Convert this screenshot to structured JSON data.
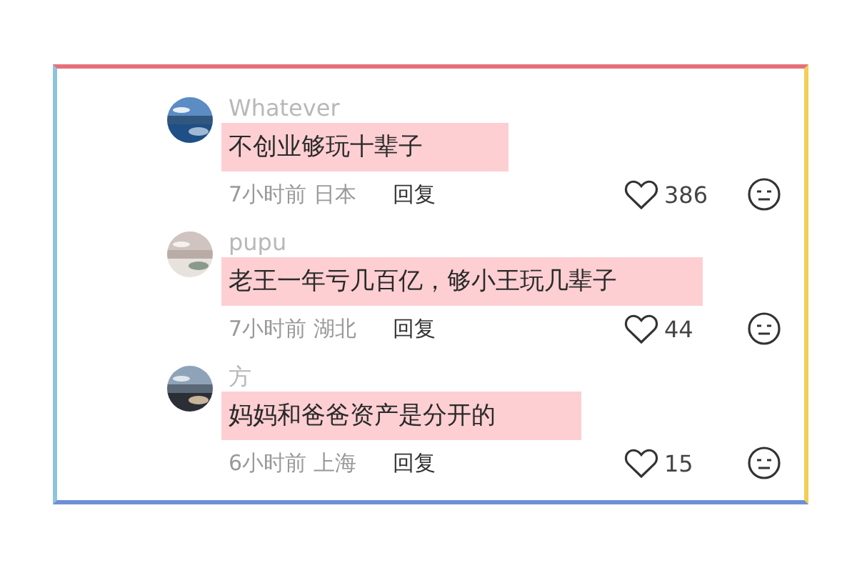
{
  "comments": [
    {
      "username": "Whatever",
      "text": "不创业够玩十辈子",
      "highlighted": true,
      "time_location": "7小时前 日本",
      "reply": "回复",
      "likes": "386"
    },
    {
      "username": "pupu",
      "text": "老王一年亏几百亿，够小王玩几辈子",
      "highlighted": true,
      "time_location": "7小时前 湖北",
      "reply": "回复",
      "likes": "44"
    },
    {
      "username": "方",
      "text": "妈妈和爸爸资产是分开的",
      "highlighted": true,
      "time_location": "6小时前 上海",
      "reply": "回复",
      "likes": "15"
    }
  ]
}
